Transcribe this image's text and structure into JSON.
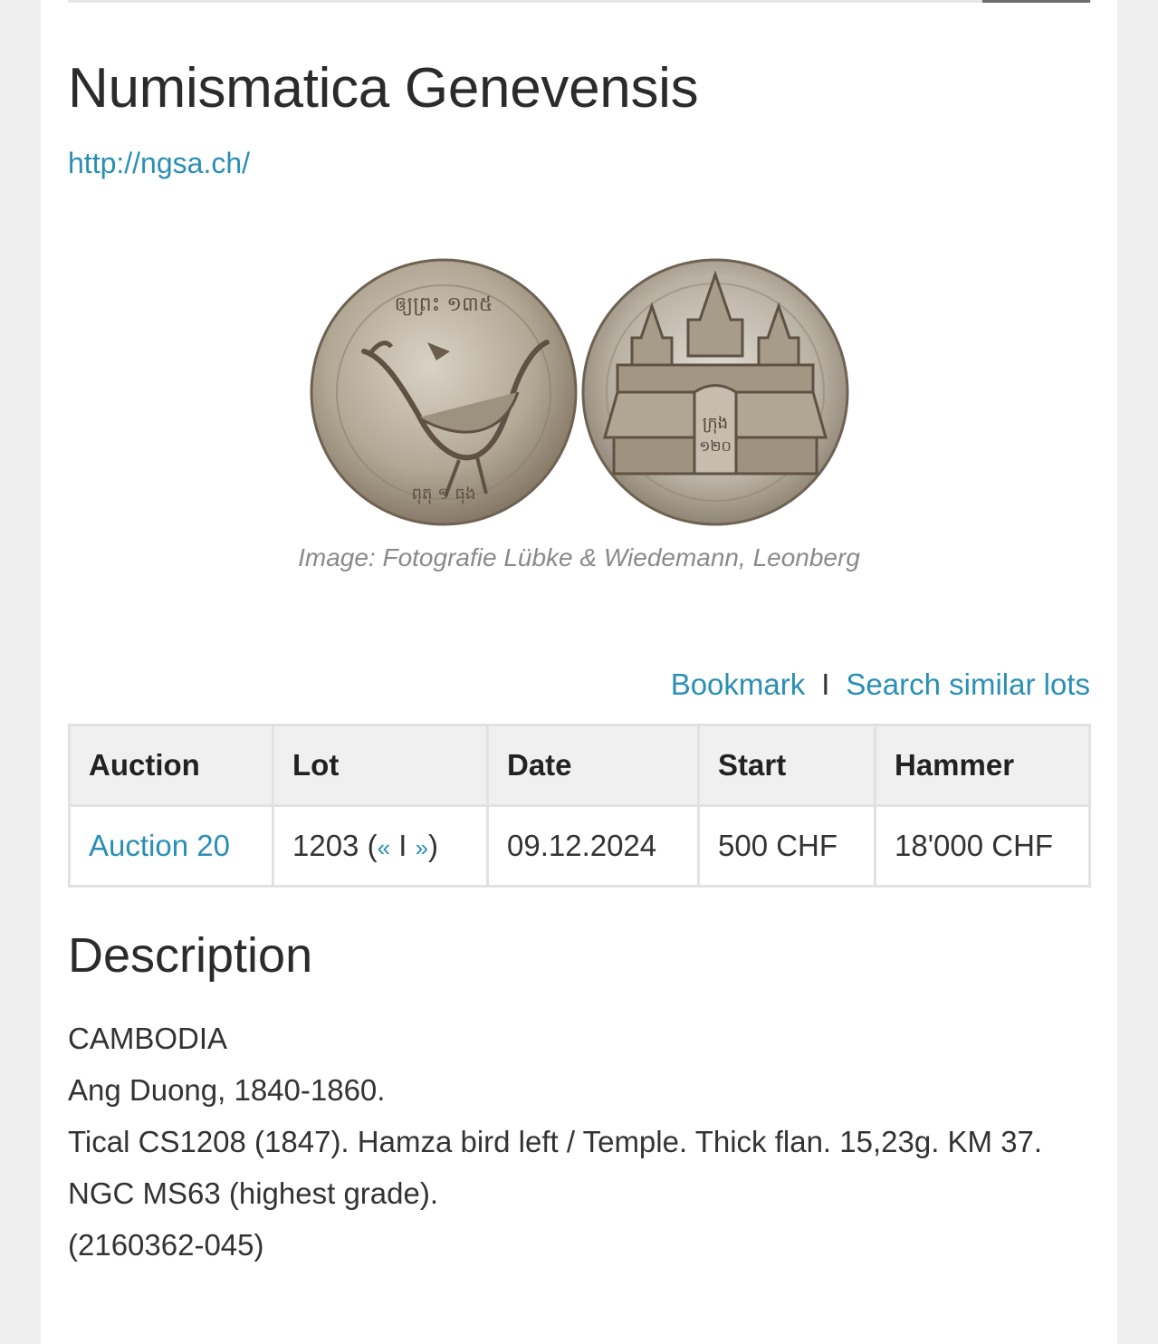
{
  "header": {
    "title": "Numismatica Genevensis",
    "website": "http://ngsa.ch/"
  },
  "image": {
    "caption": "Image: Fotografie Lübke & Wiedemann, Leonberg",
    "obverse_icon": "hamza-bird-coin-icon",
    "reverse_icon": "temple-coin-icon"
  },
  "actions": {
    "bookmark": "Bookmark",
    "separator": "I",
    "search_similar": "Search similar lots"
  },
  "lot_table": {
    "headers": [
      "Auction",
      "Lot",
      "Date",
      "Start",
      "Hammer"
    ],
    "row": {
      "auction": "Auction 20",
      "lot_number": "1203",
      "prev": "«",
      "nav_sep": "I",
      "next": "»",
      "date": "09.12.2024",
      "start": "500 CHF",
      "hammer": "18'000 CHF"
    }
  },
  "description": {
    "heading": "Description",
    "lines": [
      "CAMBODIA",
      "Ang Duong, 1840-1860.",
      "Tical CS1208 (1847). Hamza bird left / Temple. Thick flan. 15,23g. KM 37.",
      "NGC MS63 (highest grade).",
      "(2160362-045)"
    ]
  },
  "colors": {
    "link": "#2a8fb5",
    "text": "#333333",
    "table_header_bg": "#f0f0f0"
  }
}
